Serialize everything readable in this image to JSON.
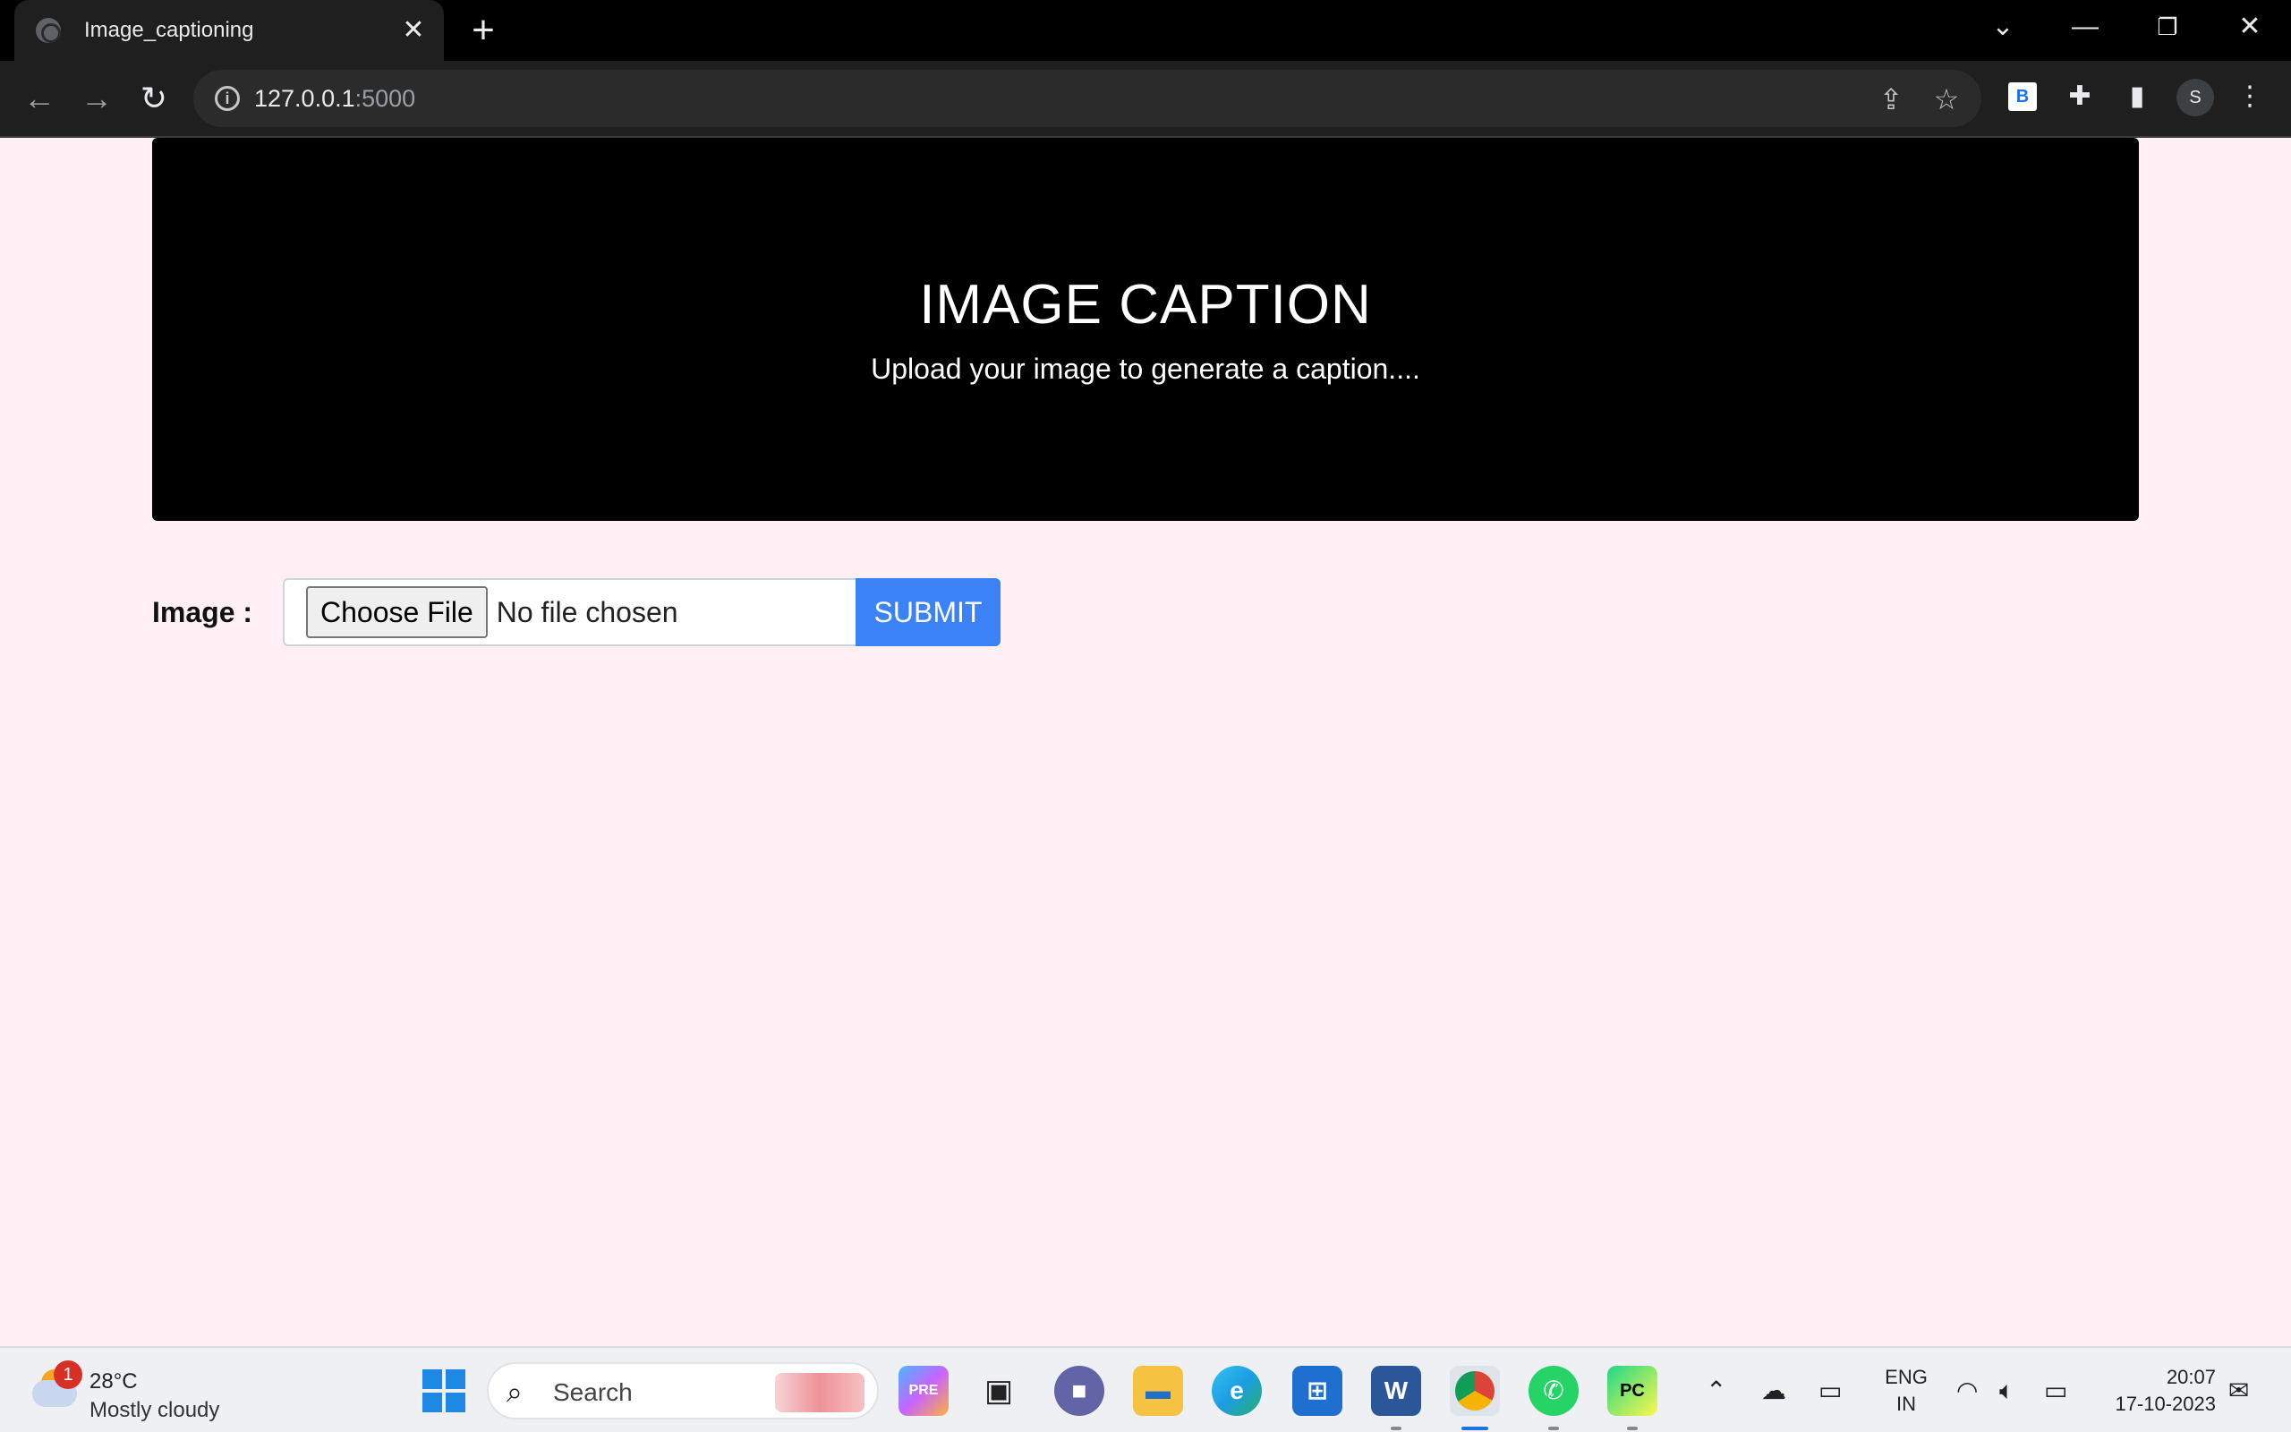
{
  "browser": {
    "tab_title": "Image_captioning",
    "url_host": "127.0.0.1",
    "url_port": ":5000",
    "extension_label": "B",
    "profile_initial": "S"
  },
  "page": {
    "hero_title": "IMAGE CAPTION",
    "hero_subtitle": "Upload your image to generate a caption....",
    "form_label": "Image :",
    "file_button": "Choose File",
    "file_status": "No file chosen",
    "submit_label": "SUBMIT"
  },
  "taskbar": {
    "weather_badge": "1",
    "temperature": "28°C",
    "condition": "Mostly cloudy",
    "search_placeholder": "Search",
    "lang_line1": "ENG",
    "lang_line2": "IN",
    "time": "20:07",
    "date": "17-10-2023",
    "apps": [
      "copilot-icon",
      "task-view-icon",
      "teams-icon",
      "file-explorer-icon",
      "edge-icon",
      "store-icon",
      "word-icon",
      "chrome-icon",
      "whatsapp-icon",
      "pycharm-icon"
    ]
  },
  "colors": {
    "page_bg": "#fff0f5",
    "hero_bg": "#000000",
    "submit_bg": "#3b82f6"
  }
}
